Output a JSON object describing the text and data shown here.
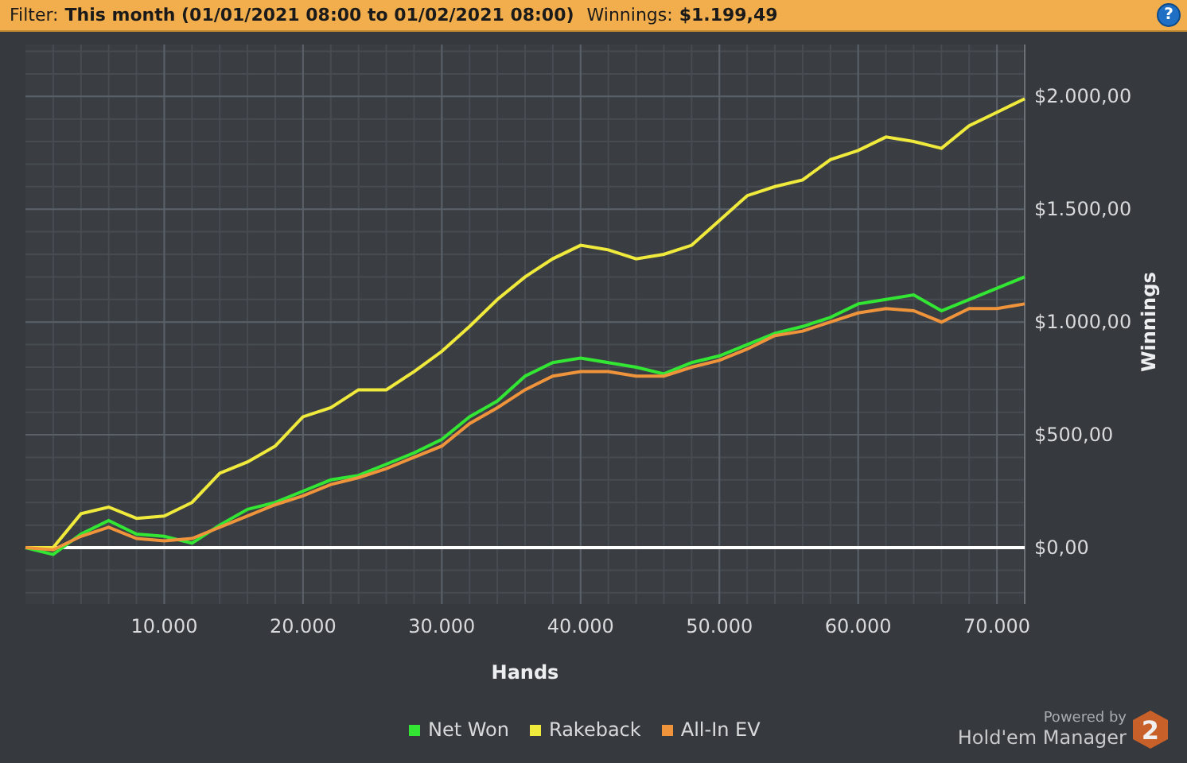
{
  "filter_bar": {
    "filter_label": "Filter:",
    "filter_value": "This month (01/01/2021 08:00 to 01/02/2021 08:00)",
    "winnings_label": "Winnings:",
    "winnings_value": "$1.199,49",
    "help_glyph": "?"
  },
  "chart": {
    "chart_data": {
      "type": "line",
      "grid": true,
      "xlabel": "Hands",
      "ylabel": "Winnings",
      "xlim": [
        0,
        72000
      ],
      "ylim": [
        -250,
        2230
      ],
      "x": [
        0,
        2000,
        4000,
        6000,
        8000,
        10000,
        12000,
        14000,
        16000,
        18000,
        20000,
        22000,
        24000,
        26000,
        28000,
        30000,
        32000,
        34000,
        36000,
        38000,
        40000,
        42000,
        44000,
        46000,
        48000,
        50000,
        52000,
        54000,
        56000,
        58000,
        60000,
        62000,
        64000,
        66000,
        68000,
        70000,
        72000
      ],
      "series": [
        {
          "name": "Net Won",
          "color": "#33e633",
          "values": [
            0,
            -30,
            60,
            120,
            60,
            50,
            20,
            100,
            170,
            200,
            250,
            300,
            320,
            370,
            420,
            480,
            580,
            650,
            760,
            820,
            840,
            820,
            800,
            770,
            820,
            850,
            900,
            950,
            980,
            1020,
            1080,
            1100,
            1120,
            1050,
            1100,
            1150,
            1200
          ]
        },
        {
          "name": "Rakeback",
          "color": "#f0ea3c",
          "values": [
            0,
            0,
            150,
            180,
            130,
            140,
            200,
            330,
            380,
            450,
            580,
            620,
            700,
            700,
            780,
            870,
            980,
            1100,
            1200,
            1280,
            1340,
            1320,
            1280,
            1300,
            1340,
            1450,
            1560,
            1600,
            1630,
            1720,
            1760,
            1820,
            1800,
            1770,
            1870,
            1930,
            1990
          ]
        },
        {
          "name": "All-In EV",
          "color": "#f0943c",
          "values": [
            0,
            -10,
            50,
            90,
            40,
            30,
            40,
            90,
            140,
            190,
            230,
            280,
            310,
            350,
            400,
            450,
            550,
            620,
            700,
            760,
            780,
            780,
            760,
            760,
            800,
            830,
            880,
            940,
            960,
            1000,
            1040,
            1060,
            1050,
            1000,
            1060,
            1060,
            1080
          ]
        }
      ],
      "xticks": [
        {
          "value": 10000,
          "label": "10.000"
        },
        {
          "value": 20000,
          "label": "20.000"
        },
        {
          "value": 30000,
          "label": "30.000"
        },
        {
          "value": 40000,
          "label": "40.000"
        },
        {
          "value": 50000,
          "label": "50.000"
        },
        {
          "value": 60000,
          "label": "60.000"
        },
        {
          "value": 70000,
          "label": "70.000"
        }
      ],
      "yticks": [
        {
          "value": 0,
          "label": "$0,00"
        },
        {
          "value": 500,
          "label": "$500,00"
        },
        {
          "value": 1000,
          "label": "$1.000,00"
        },
        {
          "value": 1500,
          "label": "$1.500,00"
        },
        {
          "value": 2000,
          "label": "$2.000,00"
        }
      ]
    }
  },
  "branding": {
    "powered_by": "Powered by",
    "product": "Hold'em Manager",
    "badge": "2"
  }
}
